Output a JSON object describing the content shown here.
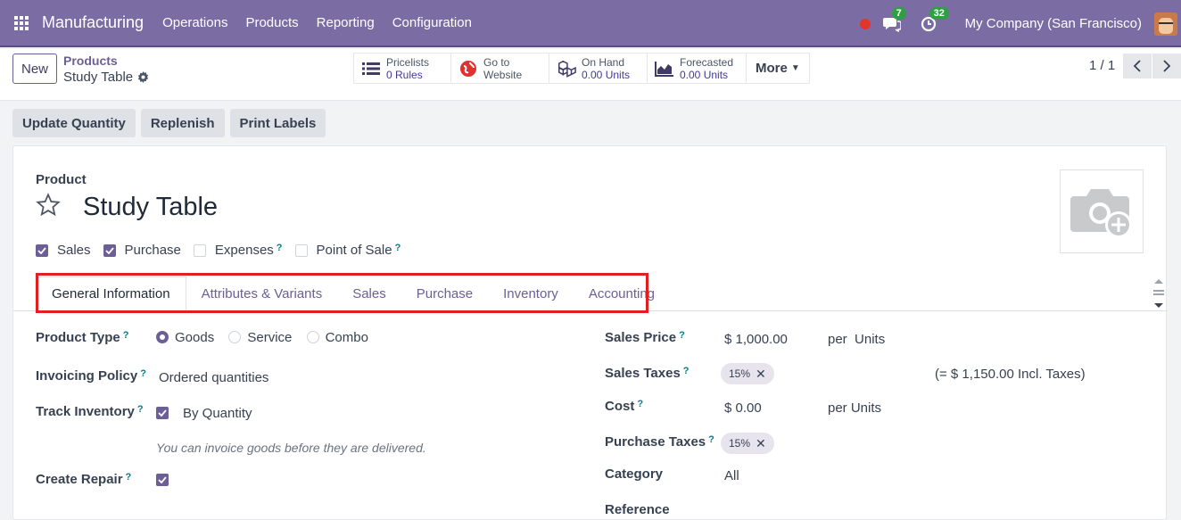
{
  "topbar": {
    "app_name": "Manufacturing",
    "menu": [
      "Operations",
      "Products",
      "Reporting",
      "Configuration"
    ],
    "messages_count": "7",
    "activities_count": "32",
    "company": "My Company (San Francisco)",
    "bg_color": "#7b6ca4"
  },
  "control": {
    "new_label": "New",
    "breadcrumb_parent": "Products",
    "breadcrumb_current": "Study Table",
    "smart_buttons": [
      {
        "icon": "list-icon",
        "title": "Pricelists",
        "value": "0 Rules"
      },
      {
        "icon": "globe-icon",
        "title": "Go to",
        "value": "Website"
      },
      {
        "icon": "cubes-icon",
        "title": "On Hand",
        "value": "0.00 Units"
      },
      {
        "icon": "area-chart-icon",
        "title": "Forecasted",
        "value": "0.00 Units"
      }
    ],
    "more_label": "More",
    "pager": "1 / 1"
  },
  "actions": [
    "Update Quantity",
    "Replenish",
    "Print Labels"
  ],
  "form": {
    "product_label": "Product",
    "product_name": "Study Table",
    "checkboxes": [
      {
        "label": "Sales",
        "checked": true,
        "help": ""
      },
      {
        "label": "Purchase",
        "checked": true,
        "help": ""
      },
      {
        "label": "Expenses",
        "checked": false,
        "help": "?"
      },
      {
        "label": "Point of Sale",
        "checked": false,
        "help": "?"
      }
    ],
    "tabs": [
      "General Information",
      "Attributes & Variants",
      "Sales",
      "Purchase",
      "Inventory",
      "Accounting"
    ],
    "active_tab": "General Information",
    "product_type_label": "Product Type",
    "product_type_options": [
      "Goods",
      "Service",
      "Combo"
    ],
    "product_type_selected": "Goods",
    "invoicing_policy_label": "Invoicing Policy",
    "invoicing_policy_value": "Ordered quantities",
    "track_inventory_label": "Track Inventory",
    "track_inventory_value": "By Quantity",
    "invoice_hint": "You can invoice goods before they are delivered.",
    "create_repair_label": "Create Repair",
    "sales_price_label": "Sales Price",
    "sales_price_value": "$ 1,000.00",
    "sales_price_unit": "per  Units",
    "sales_taxes_label": "Sales Taxes",
    "sales_tax_tag": "15%",
    "incl_taxes": "(= $ 1,150.00 Incl. Taxes)",
    "cost_label": "Cost",
    "cost_value": "$ 0.00",
    "cost_unit": "per Units",
    "purchase_taxes_label": "Purchase Taxes",
    "purchase_tax_tag": "15%",
    "category_label": "Category",
    "category_value": "All",
    "reference_label": "Reference",
    "help_mark": "?"
  }
}
